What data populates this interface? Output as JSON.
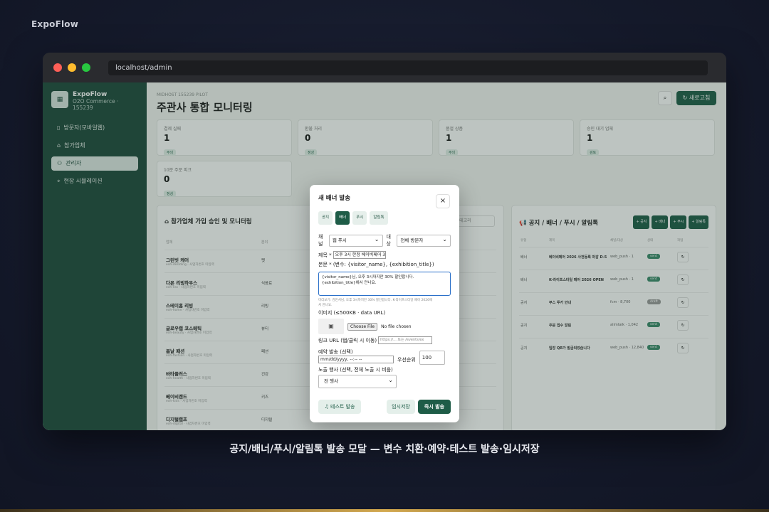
{
  "brand": "ExpoFlow",
  "caption": "공지/배너/푸시/알림톡 발송 모달 — 변수 치환·예약·테스트 발송·임시저장",
  "url": "localhost/admin",
  "sidebar": {
    "app": "ExpoFlow",
    "sub1": "O2O Commerce ·",
    "sub2": "155239",
    "items": [
      {
        "icon": "phone-icon",
        "label": "방문자(모바일웹)"
      },
      {
        "icon": "store-icon",
        "label": "참가업체"
      },
      {
        "icon": "users-icon",
        "label": "관리자"
      },
      {
        "icon": "pin-icon",
        "label": "현장 시뮬레이션"
      }
    ]
  },
  "header": {
    "pre": "MIDHOST 155239 PILOT",
    "title": "주관사 통합 모니터링",
    "refresh": "새로고침"
  },
  "cards": [
    {
      "label": "결제 실패",
      "value": "1",
      "badge": "주의"
    },
    {
      "label": "환불 처리",
      "value": "0",
      "badge": "정상"
    },
    {
      "label": "품절 상품",
      "value": "1",
      "badge": "주의"
    },
    {
      "label": "승인 대기 업체",
      "value": "1",
      "badge": "검토"
    },
    {
      "label": "10분 주문 피크",
      "value": "0",
      "badge": "정상"
    }
  ],
  "left": {
    "title": "참가업체 가입 승인 및 모니터링",
    "filter": "사업자번호/카테고리",
    "col1": "업체",
    "col2": "분야",
    "rows": [
      {
        "name": "그린빗 케어",
        "sub": "exh-deslding · 사업자번호 미입력",
        "cat": "펫"
      },
      {
        "name": "다온 리빙하우스",
        "sub": "exh-liss · 사업자번호 미입력",
        "cat": "식음료"
      },
      {
        "name": "스테이홈 리빙",
        "sub": "exh-home · 사업자번호 미입력",
        "cat": "리빙"
      },
      {
        "name": "글로우랩 코스메틱",
        "sub": "exh-beauty · 사업자번호 미입력",
        "cat": "뷰티"
      },
      {
        "name": "봄날 패션",
        "sub": "exh-fashion · 사업자번호 미입력",
        "cat": "패션"
      },
      {
        "name": "바타플러스",
        "sub": "exh-health · 사업자번호 미입력",
        "cat": "건강"
      },
      {
        "name": "베이비랜드",
        "sub": "exh-kids · 사업자번호 미입력",
        "cat": "키즈"
      },
      {
        "name": "디지털랩프",
        "sub": "exh-digital · 사업자번호 미입력",
        "cat": "디지털"
      }
    ]
  },
  "right": {
    "title": "공지 / 배너 / 푸시 / 알림톡",
    "buttons": [
      "+ 공지",
      "+ 배너",
      "+ 푸시",
      "+ 알림톡"
    ],
    "cols": [
      "유형",
      "제목",
      "채널/대상",
      "상태",
      "작업"
    ],
    "rows": [
      {
        "type": "배너",
        "title": "베이비페어 2026 사전등록 마감 D-5",
        "ch": "web_push · 1",
        "st": "sent"
      },
      {
        "type": "배너",
        "title": "K-라이프스타일 페어 2026 OPEN",
        "ch": "web_push · 1",
        "st": "sent"
      },
      {
        "type": "공지",
        "title": "부스 투가 안내",
        "ch": "fcm · 8,700",
        "st": "draft"
      },
      {
        "type": "공지",
        "title": "주문 접수 알림",
        "ch": "alimtalk · 1,042",
        "st": "sent"
      },
      {
        "type": "공지",
        "title": "입장 QR가 발급되었습니다",
        "ch": "web_push · 12,840",
        "st": "sent"
      }
    ]
  },
  "modal": {
    "title": "새 배너 발송",
    "tabs": [
      "공지",
      "배너",
      "푸시",
      "알림톡"
    ],
    "channel_label": "채널",
    "channel_value": "웹 푸시",
    "target_label": "대상",
    "target_value": "전체 방문자",
    "title_label": "제목 *",
    "title_value": "오후 3시 한정 베이비페어 3",
    "body_label": "본문 * (변수: {visitor_name}, {exhibition_title})",
    "body_line1": "{visitor_name}님, 오후 3시까지만 30% 할인합니다.",
    "body_line2": "{exhibition_title}에서 만나요.",
    "preview_line1": "미리보기: 김민서님, 오후 3시까지만 30% 할인합니다. K-라이프스타일 페어 2026에",
    "preview_line2": "서 만나요.",
    "image_label": "이미지 (≤500KB · data URL)",
    "file_button": "Choose File",
    "file_status": "No file chosen",
    "link_label": "링크 URL (탭/클릭 시 이동)",
    "link_placeholder": "https://... 또는 /events/ex",
    "schedule_label": "예약 발송 (선택)",
    "schedule_value": "mm/dd/yyyy, --:-- --",
    "priority_label": "우선순위",
    "priority_value": "100",
    "exhibition_label": "노출 행사 (선택, 전체 노출 시 비움)",
    "exhibition_value": "전 행사",
    "test_button": "테스트 발송",
    "draft_button": "임시저장",
    "send_button": "즉시 발송"
  }
}
